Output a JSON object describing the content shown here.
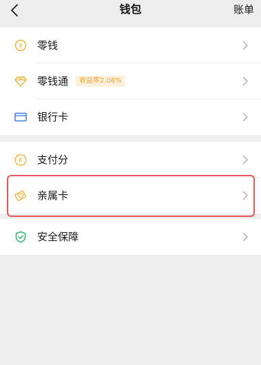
{
  "header": {
    "title": "钱包",
    "bill_label": "账单",
    "back_icon": "chevron-left-icon"
  },
  "groups": [
    {
      "items": [
        {
          "key": "change",
          "label": "零钱",
          "icon": "yen-coin-icon"
        },
        {
          "key": "licaitong",
          "label": "零钱通",
          "icon": "diamond-icon",
          "badge": "收益率2.06%"
        },
        {
          "key": "bankcard",
          "label": "银行卡",
          "icon": "card-icon"
        }
      ]
    },
    {
      "items": [
        {
          "key": "payscore",
          "label": "支付分",
          "icon": "score-badge-icon"
        },
        {
          "key": "familycard",
          "label": "亲属卡",
          "icon": "heart-card-icon",
          "highlighted": true
        },
        {
          "key": "security",
          "label": "安全保障",
          "icon": "shield-icon"
        }
      ]
    }
  ],
  "colors": {
    "background": "#ededed",
    "card": "#ffffff",
    "icon_gold": "#f0b43c",
    "icon_blue": "#3d7fe0",
    "icon_green": "#2bb673",
    "badge_bg": "#fdf0dc",
    "badge_text": "#e8a33a",
    "highlight_border": "#e8545a"
  }
}
